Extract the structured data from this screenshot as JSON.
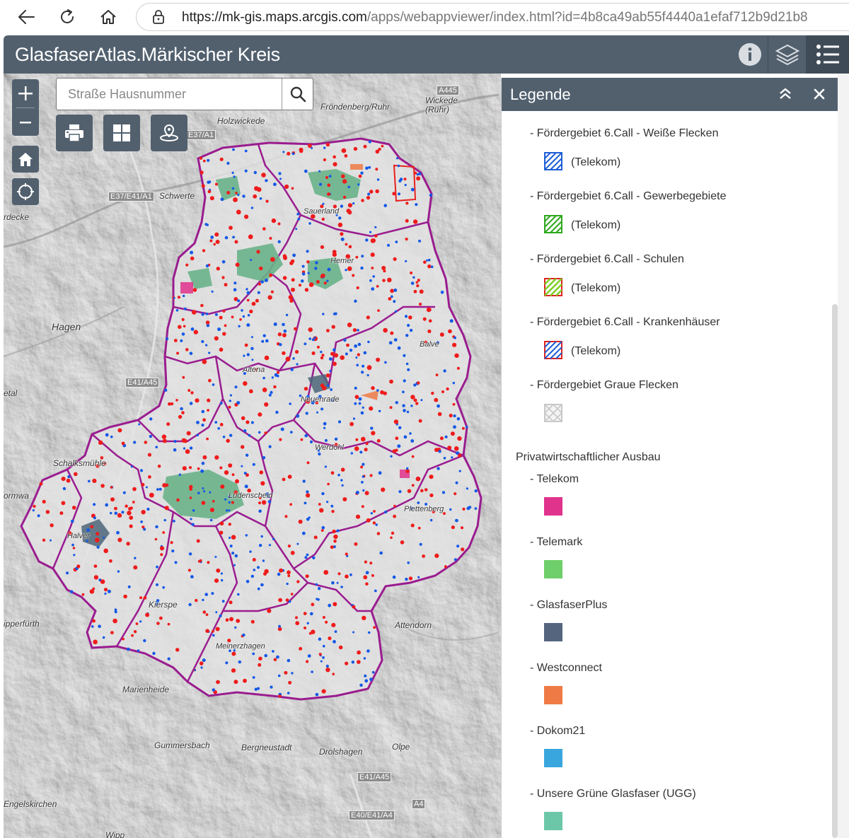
{
  "browser": {
    "url_host": "https://mk-gis.maps.arcgis.com",
    "url_path": "/apps/webappviewer/index.html?id=4b8ca49ab55f4440a1efaf712b9d21b8"
  },
  "header": {
    "title": "GlasfaserAtlas.Märkischer Kreis"
  },
  "search": {
    "placeholder": "Straße Hausnummer"
  },
  "map": {
    "labels": [
      "Fröndenberg/Ruhr",
      "Wickede (Ruhr)",
      "Holzwickede",
      "Schwerte",
      "rdecke",
      "Hagen",
      "etal",
      "Schalksmühle",
      "ormwa",
      "Kierspe",
      "ipperfürth",
      "Attendorn",
      "Marienheide",
      "Gummersbach",
      "Bergneustadt",
      "Drolshagen",
      "Olpe",
      "Engelskirchen",
      "Wipp",
      "Sauerland",
      "Hemer",
      "Balve",
      "Altena",
      "Werdohl",
      "Neuenrade",
      "Lüdenscheid",
      "Plettenberg",
      "Halver",
      "Meinerzhagen"
    ],
    "shields": [
      "A445",
      "E37/A1",
      "E37/E41/A1",
      "E41/A45",
      "E41/A45",
      "A4",
      "E40/E41/A4"
    ]
  },
  "legend": {
    "title": "Legende",
    "items": [
      {
        "label": "- Fördergebiet 6.Call - Weiße Flecken",
        "sub": "(Telekom)",
        "swatch": "hatch",
        "color": "#1f5fd6"
      },
      {
        "label": "- Fördergebiet 6.Call - Gewerbegebiete",
        "sub": "(Telekom)",
        "swatch": "hatch",
        "color": "#2ea81e"
      },
      {
        "label": "- Fördergebiet 6.Call - Schulen",
        "sub": "(Telekom)",
        "swatch": "hatch-school",
        "color": "#7bcf21"
      },
      {
        "label": "- Fördergebiet 6.Call - Krankenhäuser",
        "sub": "(Telekom)",
        "swatch": "hatch-hosp",
        "color": "#1f5fd6"
      },
      {
        "label": "- Fördergebiet Graue Flecken",
        "sub": "",
        "swatch": "cross",
        "color": "#c8c8c8"
      }
    ],
    "section": "Privatwirtschaftlicher Ausbau",
    "providers": [
      {
        "label": "- Telekom",
        "color": "#e0338b"
      },
      {
        "label": "- Telemark",
        "color": "#6fcf6a"
      },
      {
        "label": "- GlasfaserPlus",
        "color": "#55657e"
      },
      {
        "label": "- Westconnect",
        "color": "#ef7a45"
      },
      {
        "label": "- Dokom21",
        "color": "#3aa6de"
      },
      {
        "label": "- Unsere Grüne Glasfaser (UGG)",
        "color": "#6cc7a8"
      }
    ]
  }
}
